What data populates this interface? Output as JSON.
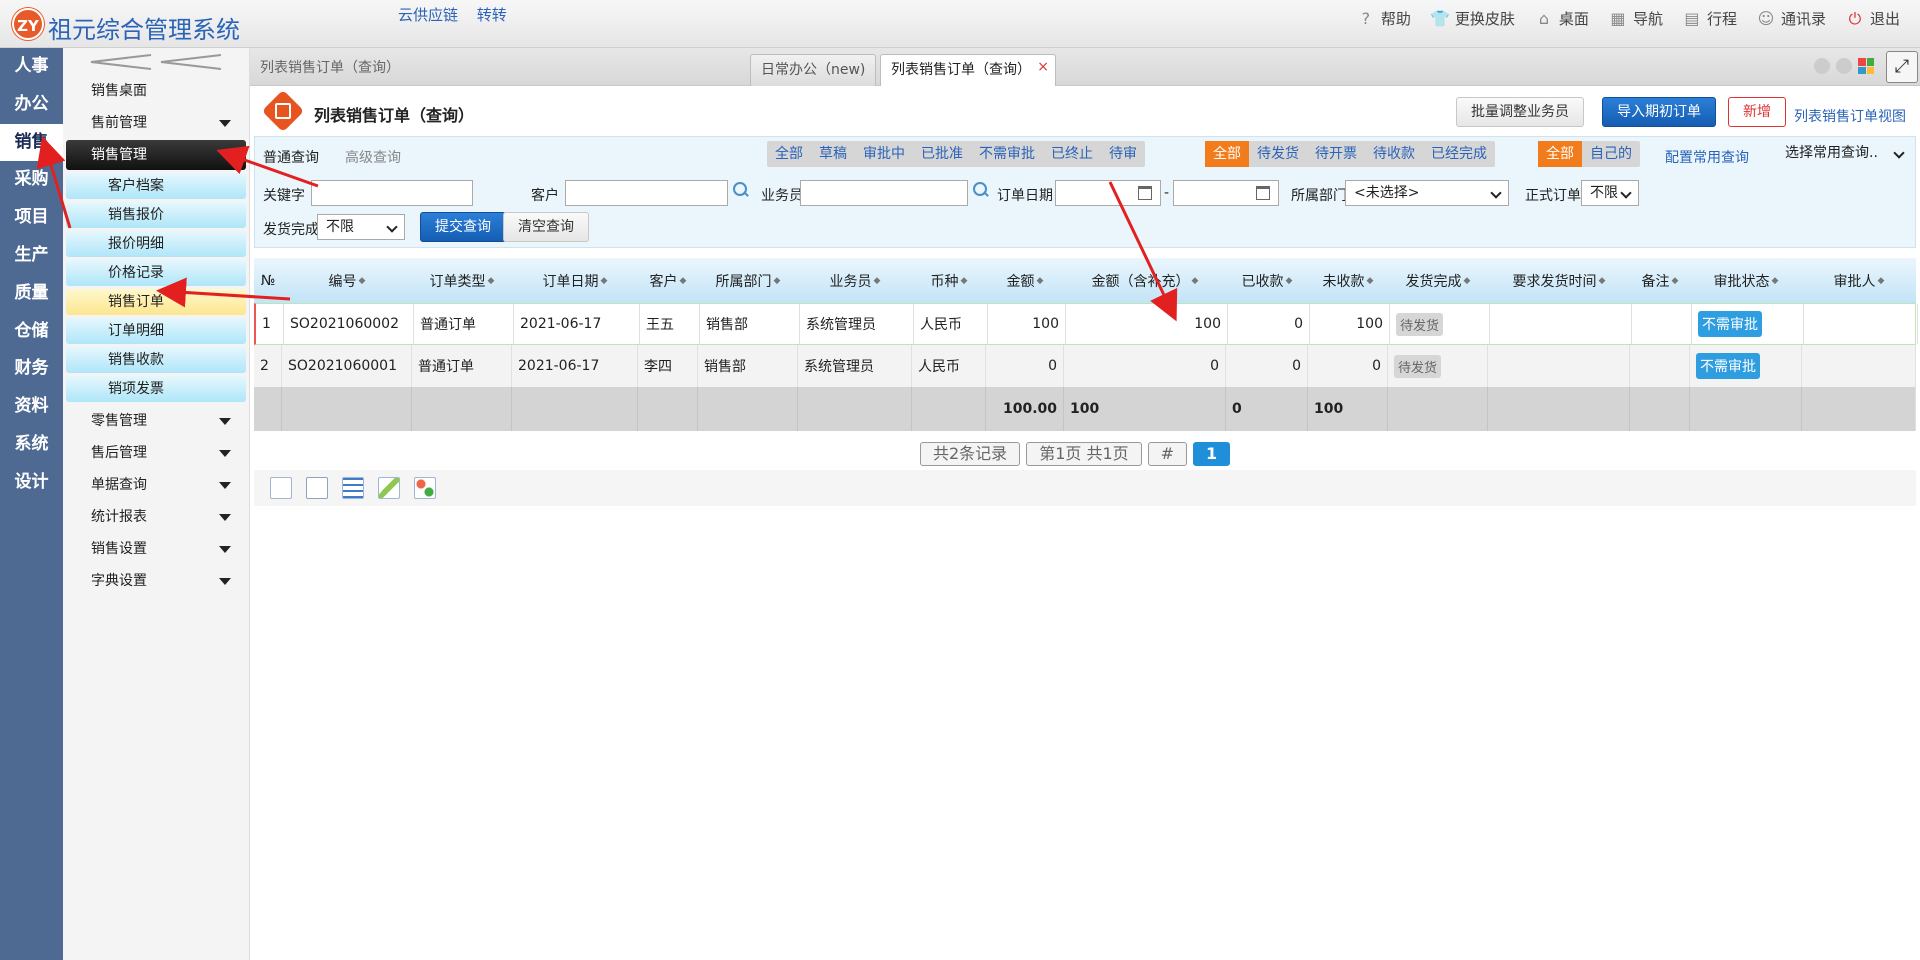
{
  "app": {
    "logo_text": "ZY",
    "title": "祖元综合管理系统"
  },
  "top_links": [
    "云供应链",
    "转转"
  ],
  "top_actions": [
    {
      "icon": "help-icon",
      "label": "帮助"
    },
    {
      "icon": "shirt-icon",
      "label": "更换皮肤"
    },
    {
      "icon": "home-icon",
      "label": "桌面"
    },
    {
      "icon": "grid-icon",
      "label": "导航"
    },
    {
      "icon": "calendar-icon",
      "label": "行程"
    },
    {
      "icon": "contacts-icon",
      "label": "通讯录"
    },
    {
      "icon": "power-icon",
      "label": "退出"
    }
  ],
  "modules": [
    "人事",
    "办公",
    "销售",
    "采购",
    "项目",
    "生产",
    "质量",
    "仓储",
    "财务",
    "资料",
    "系统",
    "设计"
  ],
  "active_module": "销售",
  "sidebar": {
    "collapse_glyph": "<<",
    "groups_before": [
      {
        "label": "销售桌面",
        "has_caret": false
      },
      {
        "label": "售前管理",
        "has_caret": true
      }
    ],
    "active_group": "销售管理",
    "items": [
      "客户档案",
      "销售报价",
      "报价明细",
      "价格记录",
      "销售订单",
      "订单明细",
      "销售收款",
      "销项发票"
    ],
    "active_item": "销售订单",
    "groups_after": [
      "零售管理",
      "售后管理",
      "单据查询",
      "统计报表",
      "销售设置",
      "字典设置"
    ]
  },
  "tabs": {
    "breadcrumb": "列表销售订单（查询）",
    "tab1": "日常办公（new)",
    "tab2": "列表销售订单（查询）",
    "close_glyph": "×"
  },
  "page": {
    "title": "列表销售订单（查询）",
    "btn_batch": "批量调整业务员",
    "btn_import": "导入期初订单",
    "btn_new": "新增",
    "view_link": "列表销售订单视图"
  },
  "filter": {
    "tab_normal": "普通查询",
    "tab_advanced": "高级查询",
    "status_seg": [
      "全部",
      "草稿",
      "审批中",
      "已批准",
      "不需审批",
      "已终止",
      "待审"
    ],
    "ship_seg": [
      "全部",
      "待发货",
      "待开票",
      "待收款",
      "已经完成"
    ],
    "owner_seg": [
      "全部",
      "自己的"
    ],
    "config_link": "配置常用查询",
    "common_select": "选择常用查询..",
    "keyword_label": "关键字",
    "customer_label": "客户",
    "salesman_label": "业务员",
    "date_label": "订单日期",
    "date_sep": "-",
    "dept_label": "所属部门",
    "dept_value": "<未选择>",
    "formal_label": "正式订单",
    "formal_value": "不限",
    "ship_done_label": "发货完成",
    "ship_done_value": "不限",
    "submit": "提交查询",
    "clear": "清空查询"
  },
  "table": {
    "headers": [
      "№",
      "编号",
      "订单类型",
      "订单日期",
      "客户",
      "所属部门",
      "业务员",
      "币种",
      "金额",
      "金额（含补充）",
      "已收款",
      "未收款",
      "发货完成",
      "要求发货时间",
      "备注",
      "审批状态",
      "审批人"
    ],
    "rows": [
      [
        "1",
        "SO2021060002",
        "普通订单",
        "2021-06-17",
        "王五",
        "销售部",
        "系统管理员",
        "人民币",
        "100",
        "100",
        "0",
        "100",
        "待发货",
        "",
        "",
        "不需审批",
        ""
      ],
      [
        "2",
        "SO2021060001",
        "普通订单",
        "2021-06-17",
        "李四",
        "销售部",
        "系统管理员",
        "人民币",
        "0",
        "0",
        "0",
        "0",
        "待发货",
        "",
        "",
        "不需审批",
        ""
      ]
    ],
    "summary": {
      "amount": "100.00",
      "amount_plus": "100",
      "received": "0",
      "unreceived": "100"
    }
  },
  "pager": {
    "total": "共2条记录",
    "pages": "第1页 共1页",
    "hash": "#",
    "current": "1"
  },
  "colors": {
    "accent_orange": "#f27b1b",
    "primary_blue": "#1e8fd8",
    "nav_bg": "#4f6a92",
    "alert_red": "#dd3333"
  }
}
